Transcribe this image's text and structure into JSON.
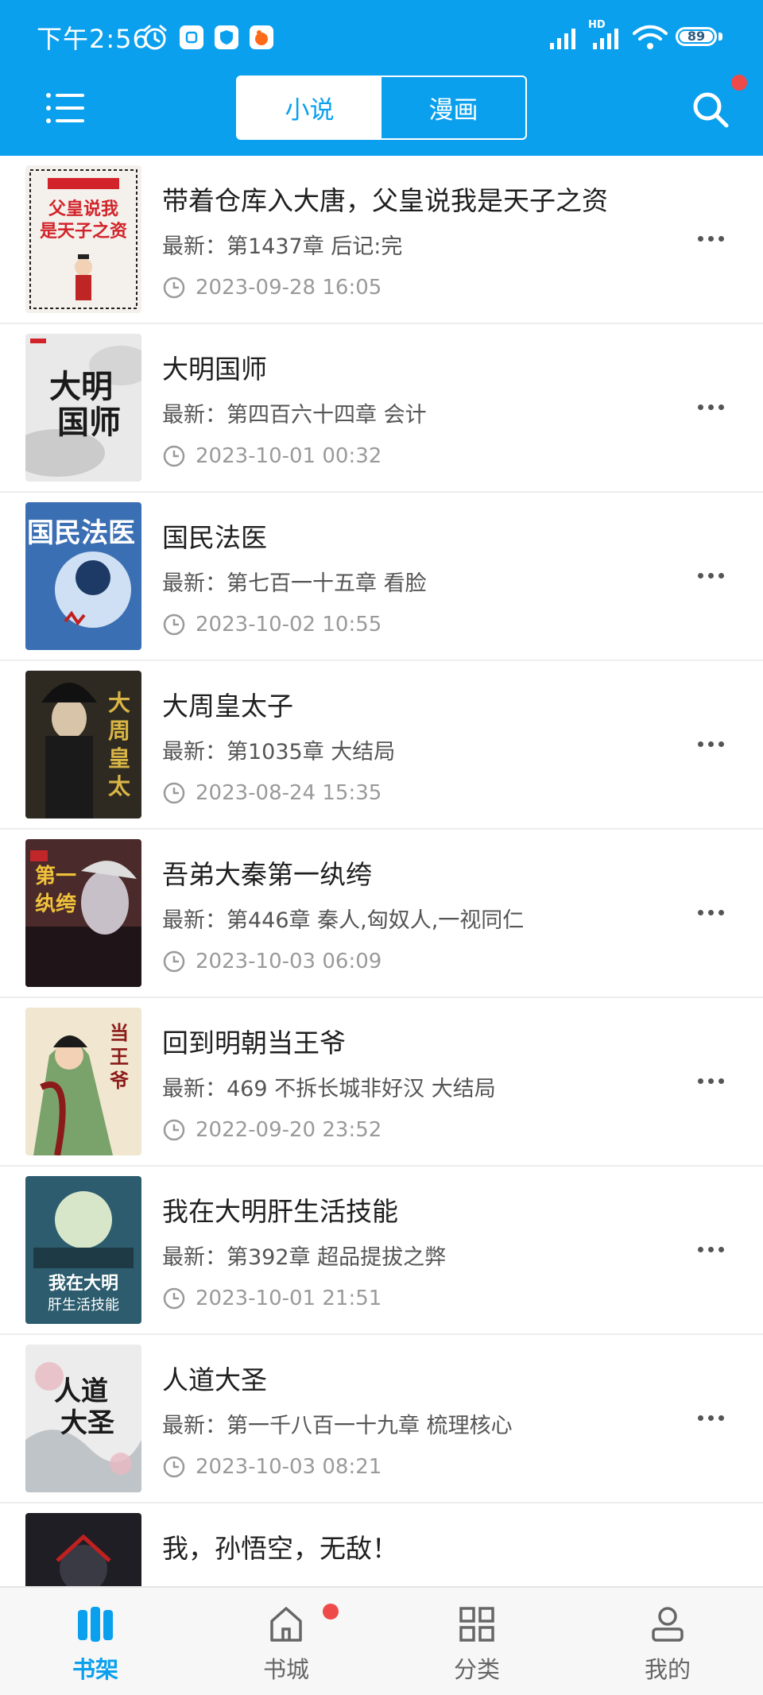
{
  "status_bar": {
    "time": "下午2:56",
    "network_label": "HD",
    "battery": "89"
  },
  "header": {
    "tabs": [
      {
        "label": "小说",
        "active": true
      },
      {
        "label": "漫画",
        "active": false
      }
    ],
    "accent_color": "#0aa0ee",
    "notification_dot_color": "#ef4a4a"
  },
  "books": [
    {
      "title": "带着仓库入大唐，父皇说我是天子之资",
      "latest": "最新：第1437章 后记:完",
      "date": "2023-09-28 16:05"
    },
    {
      "title": "大明国师",
      "latest": "最新：第四百六十四章 会计",
      "date": "2023-10-01 00:32"
    },
    {
      "title": "国民法医",
      "latest": "最新：第七百一十五章 看脸",
      "date": "2023-10-02 10:55"
    },
    {
      "title": "大周皇太子",
      "latest": "最新：第1035章 大结局",
      "date": "2023-08-24 15:35"
    },
    {
      "title": "吾弟大秦第一纨绔",
      "latest": "最新：第446章 秦人,匈奴人,一视同仁",
      "date": "2023-10-03 06:09"
    },
    {
      "title": "回到明朝当王爷",
      "latest": "最新：469 不拆长城非好汉 大结局",
      "date": "2022-09-20 23:52"
    },
    {
      "title": "我在大明肝生活技能",
      "latest": "最新：第392章 超品提拔之弊",
      "date": "2023-10-01 21:51"
    },
    {
      "title": "人道大圣",
      "latest": "最新：第一千八百一十九章 梳理核心",
      "date": "2023-10-03 08:21"
    },
    {
      "title": "我，孙悟空，无敌！",
      "latest": "",
      "date": ""
    }
  ],
  "covers": [
    {
      "text": "父皇说我是天子之资",
      "bg": "#f4f1ec",
      "fg": "#d2232a"
    },
    {
      "text": "大明国师",
      "bg": "#e9e9e9",
      "fg": "#1a1a1a"
    },
    {
      "text": "国民法医",
      "bg": "#3b6fb3",
      "fg": "#ffffff"
    },
    {
      "text": "大周皇太子",
      "bg": "#2e2a22",
      "fg": "#d9b545"
    },
    {
      "text": "吾弟大秦第一纨绔",
      "bg": "#4a2a2a",
      "fg": "#f0c23b"
    },
    {
      "text": "回到明朝当王爷",
      "bg": "#7aa36b",
      "fg": "#8b1a1a"
    },
    {
      "text": "我在大明肝生活技能",
      "bg": "#2c5c6e",
      "fg": "#ffffff"
    },
    {
      "text": "人道大圣",
      "bg": "#ececec",
      "fg": "#1a1a1a"
    },
    {
      "text": "",
      "bg": "#1e1e24",
      "fg": "#c02020"
    }
  ],
  "bottom_nav": [
    {
      "label": "书架",
      "icon": "bookshelf-icon",
      "active": true
    },
    {
      "label": "书城",
      "icon": "home-icon",
      "active": false,
      "badge": true
    },
    {
      "label": "分类",
      "icon": "category-icon",
      "active": false
    },
    {
      "label": "我的",
      "icon": "user-icon",
      "active": false
    }
  ]
}
